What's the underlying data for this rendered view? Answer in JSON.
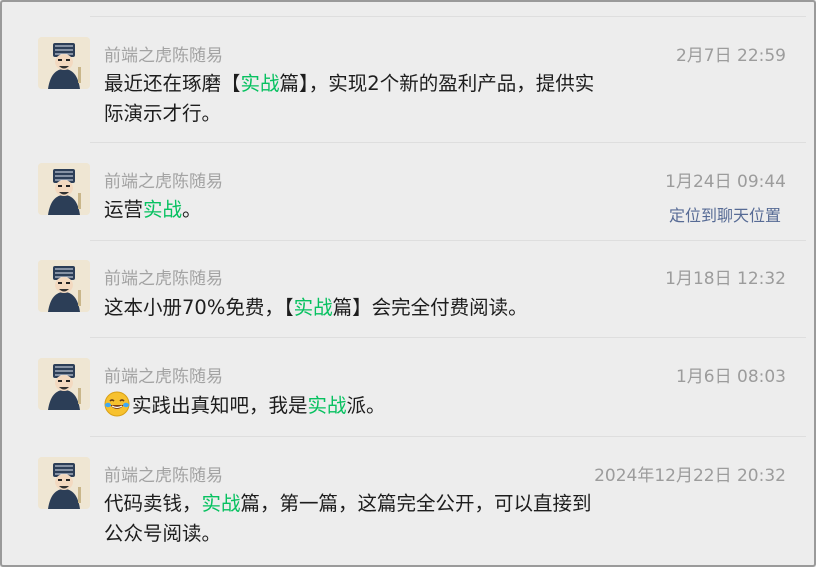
{
  "sender": "前端之虎陈随易",
  "colors": {
    "highlight": "#07c160",
    "link": "#576b95",
    "background": "#ededed"
  },
  "locate_label": "定位到聊天位置",
  "messages": [
    {
      "time": "2月7日 22:59",
      "parts": [
        "最近还在琢磨【",
        "实战",
        "篇】，实现2个新的盈利产品，提供实",
        "际演示才行。"
      ]
    },
    {
      "time": "1月24日 09:44",
      "parts": [
        "运营",
        "实战",
        "。"
      ]
    },
    {
      "time": "1月18日 12:32",
      "parts": [
        "这本小册70%免费，【",
        "实战",
        "篇】会完全付费阅读。"
      ]
    },
    {
      "time": "1月6日 08:03",
      "emoji": "face-with-tears-of-joy-emoji",
      "parts": [
        "实践出真知吧，我是",
        "实战",
        "派。"
      ]
    },
    {
      "time": "2024年12月22日 20:32",
      "parts": [
        "代码卖钱，",
        "实战",
        "篇，第一篇，这篇完全公开，可以直接到",
        "公众号阅读。"
      ]
    }
  ]
}
